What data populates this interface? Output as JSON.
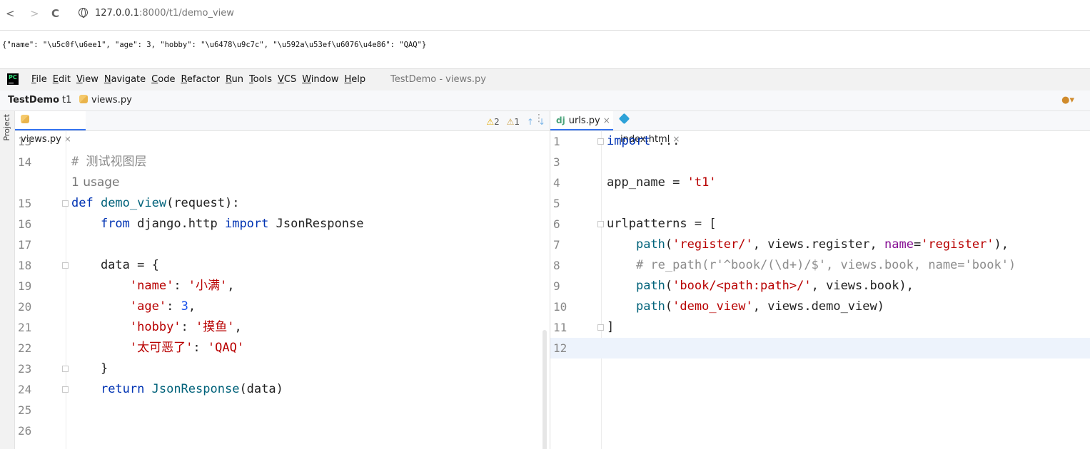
{
  "browser": {
    "back_label": "<",
    "forward_label": ">",
    "reload_label": "C",
    "url_host": "127.0.0.1",
    "url_path": ":8000/t1/demo_view",
    "json_output": "{\"name\": \"\\u5c0f\\u6ee1\", \"age\": 3, \"hobby\": \"\\u6478\\u9c7c\", \"\\u592a\\u53ef\\u6076\\u4e86\": \"QAQ\"}"
  },
  "ide": {
    "logo_text": "PC",
    "menu": [
      "File",
      "Edit",
      "View",
      "Navigate",
      "Code",
      "Refactor",
      "Run",
      "Tools",
      "VCS",
      "Window",
      "Help"
    ],
    "window_title": "TestDemo - views.py",
    "breadcrumb": {
      "project": "TestDemo",
      "module": "t1",
      "file": "views.py"
    },
    "side_label": "Project",
    "left_tab": {
      "label": "views.py",
      "close": "×"
    },
    "right_tabs": [
      {
        "label": "urls.py",
        "close": "×",
        "prefix": "dj"
      },
      {
        "label": "index.html",
        "close": "×"
      }
    ],
    "inspections": {
      "warnings": "2",
      "weak": "1"
    },
    "left_code": [
      {
        "ln": "13",
        "parts": []
      },
      {
        "ln": "14",
        "parts": [
          [
            "cmt",
            "# 测试视图层"
          ]
        ]
      },
      {
        "ln": "",
        "usage": "1 usage"
      },
      {
        "ln": "15",
        "parts": [
          [
            "kw",
            "def "
          ],
          [
            "fn",
            "demo_view"
          ],
          [
            "",
            "(request):"
          ]
        ]
      },
      {
        "ln": "16",
        "parts": [
          [
            "",
            "    "
          ],
          [
            "kw",
            "from "
          ],
          [
            "",
            "django.http "
          ],
          [
            "kw",
            "import "
          ],
          [
            "",
            "JsonResponse"
          ]
        ]
      },
      {
        "ln": "17",
        "parts": []
      },
      {
        "ln": "18",
        "parts": [
          [
            "",
            "    data = {"
          ]
        ]
      },
      {
        "ln": "19",
        "parts": [
          [
            "",
            "        "
          ],
          [
            "red",
            "'name'"
          ],
          [
            "",
            ": "
          ],
          [
            "red",
            "'小满'"
          ],
          [
            "",
            ","
          ]
        ]
      },
      {
        "ln": "20",
        "parts": [
          [
            "",
            "        "
          ],
          [
            "red",
            "'age'"
          ],
          [
            "",
            ": "
          ],
          [
            "num",
            "3"
          ],
          [
            "",
            ","
          ]
        ]
      },
      {
        "ln": "21",
        "parts": [
          [
            "",
            "        "
          ],
          [
            "red",
            "'hobby'"
          ],
          [
            "",
            ": "
          ],
          [
            "red",
            "'摸鱼'"
          ],
          [
            "",
            ","
          ]
        ]
      },
      {
        "ln": "22",
        "parts": [
          [
            "",
            "        "
          ],
          [
            "red",
            "'太可恶了'"
          ],
          [
            "",
            ": "
          ],
          [
            "red",
            "'QAQ'"
          ]
        ]
      },
      {
        "ln": "23",
        "parts": [
          [
            "",
            "    }"
          ]
        ]
      },
      {
        "ln": "24",
        "parts": [
          [
            "",
            "    "
          ],
          [
            "kw",
            "return "
          ],
          [
            "fn",
            "JsonResponse"
          ],
          [
            "",
            "(data)"
          ]
        ]
      },
      {
        "ln": "25",
        "parts": []
      },
      {
        "ln": "26",
        "parts": []
      }
    ],
    "right_code": [
      {
        "ln": "1",
        "parts": [
          [
            "kw",
            "import "
          ],
          [
            "",
            "..."
          ]
        ]
      },
      {
        "ln": "3",
        "parts": []
      },
      {
        "ln": "4",
        "parts": [
          [
            "",
            "app_name = "
          ],
          [
            "red",
            "'t1'"
          ]
        ]
      },
      {
        "ln": "5",
        "parts": []
      },
      {
        "ln": "6",
        "parts": [
          [
            "",
            "urlpatterns = ["
          ]
        ]
      },
      {
        "ln": "7",
        "parts": [
          [
            "",
            "    "
          ],
          [
            "fn",
            "path"
          ],
          [
            "",
            "("
          ],
          [
            "red",
            "'register/'"
          ],
          [
            "",
            ", views.register, "
          ],
          [
            "dk",
            "name"
          ],
          [
            "",
            "="
          ],
          [
            "red",
            "'register'"
          ],
          [
            "",
            "),"
          ]
        ]
      },
      {
        "ln": "8",
        "parts": [
          [
            "",
            "    "
          ],
          [
            "cmt",
            "# re_path(r'^book/(\\d+)/$', views.book, name='book')"
          ]
        ]
      },
      {
        "ln": "9",
        "parts": [
          [
            "",
            "    "
          ],
          [
            "fn",
            "path"
          ],
          [
            "",
            "("
          ],
          [
            "red",
            "'book/<path:path>/'"
          ],
          [
            "",
            ", views.book),"
          ]
        ]
      },
      {
        "ln": "10",
        "parts": [
          [
            "",
            "    "
          ],
          [
            "fn",
            "path"
          ],
          [
            "",
            "("
          ],
          [
            "red",
            "'demo_view'"
          ],
          [
            "",
            ", views.demo_view)"
          ]
        ]
      },
      {
        "ln": "11",
        "parts": [
          [
            "",
            "]"
          ]
        ]
      },
      {
        "ln": "12",
        "parts": []
      }
    ]
  }
}
